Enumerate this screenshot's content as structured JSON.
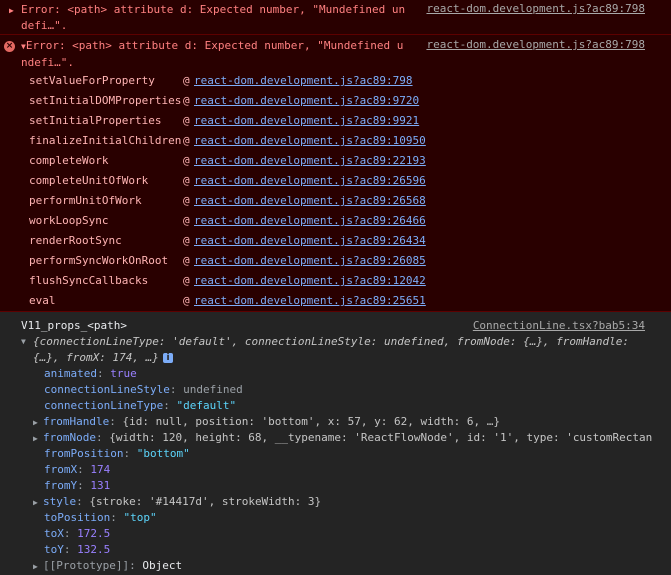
{
  "errors": [
    {
      "message": "Error: <path> attribute d: Expected number, \"Mundefined undefi…\".",
      "source": "react-dom.development.js?ac89:798"
    },
    {
      "message": "Error: <path> attribute d: Expected number, \"Mundefined undefi…\".",
      "source": "react-dom.development.js?ac89:798",
      "stack": [
        {
          "fn": "setValueForProperty",
          "loc": "react-dom.development.js?ac89:798"
        },
        {
          "fn": "setInitialDOMProperties",
          "loc": "react-dom.development.js?ac89:9720"
        },
        {
          "fn": "setInitialProperties",
          "loc": "react-dom.development.js?ac89:9921"
        },
        {
          "fn": "finalizeInitialChildren",
          "loc": "react-dom.development.js?ac89:10950"
        },
        {
          "fn": "completeWork",
          "loc": "react-dom.development.js?ac89:22193"
        },
        {
          "fn": "completeUnitOfWork",
          "loc": "react-dom.development.js?ac89:26596"
        },
        {
          "fn": "performUnitOfWork",
          "loc": "react-dom.development.js?ac89:26568"
        },
        {
          "fn": "workLoopSync",
          "loc": "react-dom.development.js?ac89:26466"
        },
        {
          "fn": "renderRootSync",
          "loc": "react-dom.development.js?ac89:26434"
        },
        {
          "fn": "performSyncWorkOnRoot",
          "loc": "react-dom.development.js?ac89:26085"
        },
        {
          "fn": "flushSyncCallbacks",
          "loc": "react-dom.development.js?ac89:12042"
        },
        {
          "fn": "eval",
          "loc": "react-dom.development.js?ac89:25651"
        }
      ]
    }
  ],
  "log": {
    "label": "V11_props_<path>",
    "source": "ConnectionLine.tsx?bab5:34",
    "preview_line1": "{connectionLineType: 'default', connectionLineStyle: undefined, fromNode: {…}, fromHandle:",
    "preview_line2": "{…}, fromX: 174, …}",
    "info_icon": "i",
    "props": {
      "animated": {
        "key": "animated",
        "value": "true"
      },
      "connectionLineStyle": {
        "key": "connectionLineStyle",
        "value": "undefined"
      },
      "connectionLineType": {
        "key": "connectionLineType",
        "value": "\"default\""
      },
      "fromHandle": {
        "key": "fromHandle",
        "value": "{id: null, position: 'bottom', x: 57, y: 62, width: 6, …}"
      },
      "fromNode": {
        "key": "fromNode",
        "value": "{width: 120, height: 68, __typename: 'ReactFlowNode', id: '1', type: 'customRectan"
      },
      "fromPosition": {
        "key": "fromPosition",
        "value": "\"bottom\""
      },
      "fromX": {
        "key": "fromX",
        "value": "174"
      },
      "fromY": {
        "key": "fromY",
        "value": "131"
      },
      "style": {
        "key": "style",
        "value": "{stroke: '#14417d', strokeWidth: 3}"
      },
      "toPosition": {
        "key": "toPosition",
        "value": "\"top\""
      },
      "toX": {
        "key": "toX",
        "value": "172.5"
      },
      "toY": {
        "key": "toY",
        "value": "132.5"
      },
      "prototype": {
        "key": "[[Prototype]]",
        "value": "Object"
      }
    }
  },
  "colors": {
    "error_bg": "#290000",
    "error_text": "#ff8080",
    "link": "#7cacf8",
    "console_bg": "#242424"
  }
}
